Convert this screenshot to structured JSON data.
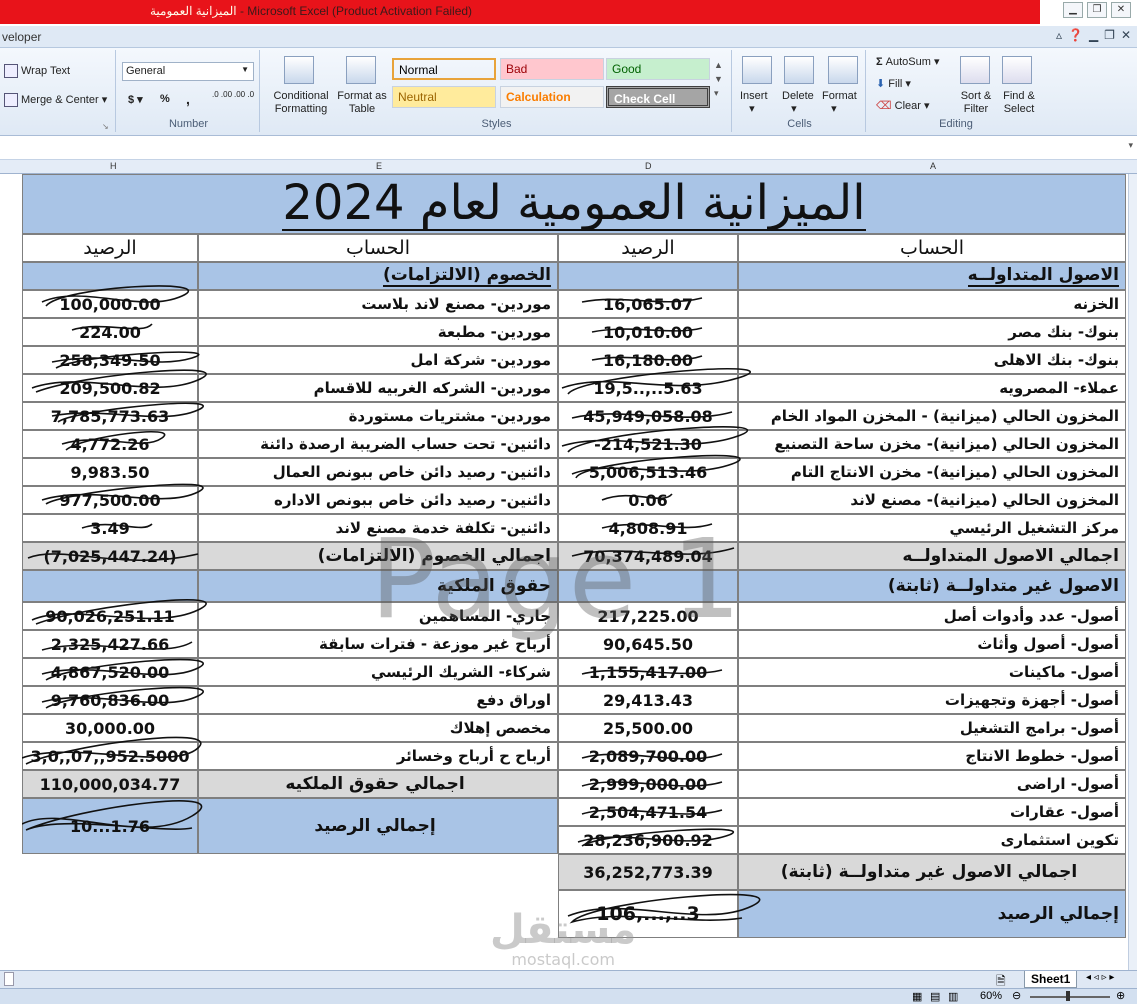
{
  "window": {
    "title_arabic": "الميزانية العمومية",
    "title_rest": " - Microsoft Excel (Product Activation Failed)"
  },
  "tabs": {
    "partial_tab": "veloper"
  },
  "ribbon": {
    "wrap_text": "Wrap Text",
    "merge_center": "Merge & Center",
    "number_format": "General",
    "currency": "$",
    "percent": "%",
    "comma": ",",
    "inc_decimal": ".0 .00",
    "dec_decimal": ".00 .0",
    "number_group": "Number",
    "conditional_formatting": "Conditional Formatting",
    "format_as_table": "Format as Table",
    "styles": [
      {
        "label": "Normal",
        "bg": "#ffffff",
        "fg": "#000000"
      },
      {
        "label": "Bad",
        "bg": "#ffc7ce",
        "fg": "#9c0006"
      },
      {
        "label": "Good",
        "bg": "#c6efce",
        "fg": "#006100"
      },
      {
        "label": "Neutral",
        "bg": "#ffeb9c",
        "fg": "#9c6500"
      },
      {
        "label": "Calculation",
        "bg": "#f2f2f2",
        "fg": "#fa7d00"
      },
      {
        "label": "Check Cell",
        "bg": "#a5a5a5",
        "fg": "#ffffff"
      }
    ],
    "styles_group": "Styles",
    "insert": "Insert",
    "delete": "Delete",
    "format": "Format",
    "cells_group": "Cells",
    "autosum": "AutoSum",
    "fill": "Fill",
    "clear": "Clear",
    "sort_filter": "Sort & Filter",
    "find_select": "Find & Select",
    "editing_group": "Editing"
  },
  "columns": {
    "h": "H",
    "e": "E",
    "d": "D",
    "a": "A"
  },
  "sheet": {
    "title": "الميزانية العمومية لعام 2024",
    "header_account": "الحساب",
    "header_balance": "الرصيد",
    "left_section_1": "الخصوم (الالتزامات)",
    "right_section_1": "الاصول المتداولــه",
    "rows": [
      {
        "l_bal": "100,000.00",
        "l_acc": "موردين- مصنع لاند بلاست",
        "r_bal": "16,065.07",
        "r_acc": "الخزنه"
      },
      {
        "l_bal": "224.00",
        "l_acc": "موردين- مطبعة",
        "r_bal": "10,010.00",
        "r_acc": "بنوك- بنك مصر"
      },
      {
        "l_bal": "258,349.50",
        "l_acc": "موردين- شركة امل",
        "r_bal": "16,180.00",
        "r_acc": "بنوك- بنك الاهلى"
      },
      {
        "l_bal": "209,500.82",
        "l_acc": "موردين- الشركه الغربيه للاقسام",
        "r_bal": "19,5..,..5.63",
        "r_acc": "عملاء- المصرويه"
      },
      {
        "l_bal": "7,785,773.63",
        "l_acc": "موردين- مشتريات مستوردة",
        "r_bal": "45,949,058.08",
        "r_acc": "المخزون الحالي (ميزانية) - المخزن المواد الخام"
      },
      {
        "l_bal": "4,772.26",
        "l_acc": "دائنين- تحت حساب الضريبة ارصدة دائنة",
        "r_bal": "-214,521.30",
        "r_acc": "المخزون الحالي (ميزانية)- مخزن ساحة التصنيع"
      },
      {
        "l_bal": "9,983.50",
        "l_acc": "دائنين- رصيد دائن خاص ببونص العمال",
        "r_bal": "5,006,513.46",
        "r_acc": "المخزون الحالي (ميزانية)- مخزن الانتاج التام"
      },
      {
        "l_bal": "977,500.00",
        "l_acc": "دائنين- رصيد دائن خاص ببونص الاداره",
        "r_bal": "0.06",
        "r_acc": "المخزون الحالي (ميزانية)- مصنع لاند"
      },
      {
        "l_bal": "3.49",
        "l_acc": "دائنين- تكلفة خدمة مصنع لاند",
        "r_bal": "4,808.91",
        "r_acc": "مركز التشغيل الرئيسي"
      }
    ],
    "left_total_1_bal": "(7,025,447.24)",
    "left_total_1_label": "اجمالي الخصوم (الالتزامات)",
    "right_total_1_bal": "70,374,489.04",
    "right_total_1_label": "اجمالي الاصول المتداولــه",
    "left_section_2": "حقوق الملكية",
    "right_section_2": "الاصول غير متداولــة (ثابتة)",
    "rows2": [
      {
        "l_bal": "90,026,251.11",
        "l_acc": "جاري- المساهمين",
        "r_bal": "217,225.00",
        "r_acc": "أصول- عدد وأدوات أصل"
      },
      {
        "l_bal": "2,325,427.66",
        "l_acc": "أرباح غير موزعة - فترات سابقة",
        "r_bal": "90,645.50",
        "r_acc": "أصول- أصول وأثاث"
      },
      {
        "l_bal": "4,867,520.00",
        "l_acc": "شركاء- الشريك الرئيسي",
        "r_bal": "1,155,417.00",
        "r_acc": "أصول- ماكينات"
      },
      {
        "l_bal": "9,760,836.00",
        "l_acc": "اوراق دفع",
        "r_bal": "29,413.43",
        "r_acc": "أصول- أجهزة وتجهيزات"
      },
      {
        "l_bal": "30,000.00",
        "l_acc": "مخصص إهلاك",
        "r_bal": "25,500.00",
        "r_acc": "أصول- برامج التشغيل"
      },
      {
        "l_bal": "3,0,,07,,952.5000",
        "l_acc": "أرباح ح أرباح وخسائر",
        "r_bal": "2,089,700.00",
        "r_acc": "أصول- خطوط الانتاج"
      }
    ],
    "left_total_2_bal": "110,000,034.77",
    "left_total_2_label": "اجمالي حقوق الملكيه",
    "right_row_land_bal": "2,999,000.00",
    "right_row_land_acc": "أصول- اراضى",
    "right_row_realestate_bal": "2,504,471.54",
    "right_row_realestate_acc": "أصول- عقارات",
    "right_row_invest_bal": "28,236,900.92",
    "right_row_invest_acc": "تكوين استثمارى",
    "left_grand_label": "إجمالي الرصيد",
    "left_grand_bal": "10...1.76",
    "right_total_2_bal": "36,252,773.39",
    "right_total_2_label": "اجمالي الاصول غير متداولــة (ثابتة)",
    "right_grand_bal": "106,...,..3",
    "right_grand_label": "إجمالي الرصيد"
  },
  "watermark": "Page 1",
  "logo": {
    "arabic": "مستقل",
    "latin": "mostaql.com"
  },
  "sheet_tab": "Sheet1",
  "zoom": "60%"
}
